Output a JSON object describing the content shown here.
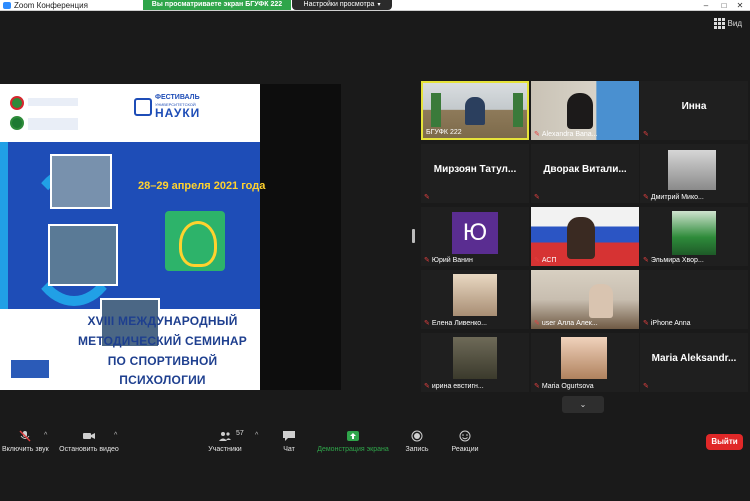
{
  "window": {
    "title": "Zoom Конференция"
  },
  "share_banner": {
    "text": "Вы просматриваете экран БГУФК 222",
    "view_options": "Настройки просмотра"
  },
  "view_button": {
    "label": "Вид"
  },
  "slide": {
    "festival_line1": "ФЕСТИВАЛЬ",
    "festival_line2": "УНИВЕРСИТЕТСКОЙ",
    "festival_line3": "НАУКИ",
    "dates": "28–29 апреля 2021 года",
    "title_line1": "XVIII МЕЖДУНАРОДНЫЙ",
    "title_line2": "МЕТОДИЧЕСКИЙ СЕМИНАР",
    "title_line3": "ПО СПОРТИВНОЙ ПСИХОЛОГИИ"
  },
  "participants": [
    {
      "name": "БГУФК 222",
      "muted": false,
      "type": "video",
      "active": true
    },
    {
      "name": "Alexandra Bana...",
      "muted": true,
      "type": "video"
    },
    {
      "name": "Инна",
      "muted": true,
      "type": "name"
    },
    {
      "name": "Мирзоян Татул...",
      "muted": true,
      "type": "name"
    },
    {
      "name": "Дворак Витали...",
      "muted": true,
      "type": "name"
    },
    {
      "name": "Дмитрий Мико...",
      "muted": true,
      "type": "video"
    },
    {
      "name": "Юрий Ванин",
      "muted": true,
      "type": "avatar",
      "initial": "Ю"
    },
    {
      "name": "АСП",
      "muted": true,
      "type": "video"
    },
    {
      "name": "Эльмира Хвор...",
      "muted": true,
      "type": "video"
    },
    {
      "name": "Елена Ливенко...",
      "muted": true,
      "type": "video"
    },
    {
      "name": "user Алла Алек...",
      "muted": true,
      "type": "video"
    },
    {
      "name": "iPhone Anna",
      "muted": true,
      "type": "video-off"
    },
    {
      "name": "ирина евстигн...",
      "muted": true,
      "type": "video"
    },
    {
      "name": "Maria Ogurtsova",
      "muted": true,
      "type": "video"
    },
    {
      "name": "Maria Aleksandr...",
      "muted": true,
      "type": "name"
    }
  ],
  "toolbar": {
    "unmute": "Включить звук",
    "start_video": "Остановить видео",
    "participants": "Участники",
    "participants_count": "57",
    "chat": "Чат",
    "share": "Демонстрация экрана",
    "record": "Запись",
    "reactions": "Реакции",
    "end": "Выйти"
  },
  "colors": {
    "share_green": "#2fa54a",
    "end_red": "#e02828",
    "slide_blue": "#1e4db7",
    "date_yellow": "#ffd22e",
    "active_border": "#e6e33a"
  }
}
